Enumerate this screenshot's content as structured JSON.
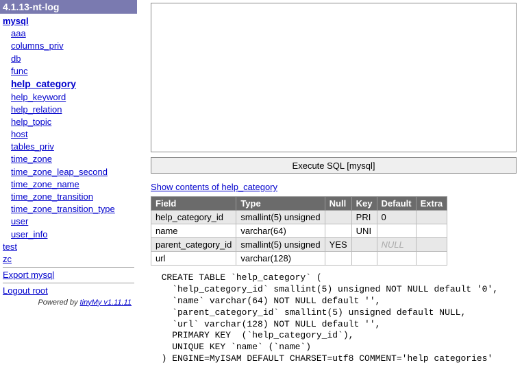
{
  "sidebar": {
    "header": "4.1.13-nt-log",
    "db": "mysql",
    "tables": [
      "aaa",
      "columns_priv",
      "db",
      "func",
      "help_category",
      "help_keyword",
      "help_relation",
      "help_topic",
      "host",
      "tables_priv",
      "time_zone",
      "time_zone_leap_second",
      "time_zone_name",
      "time_zone_transition",
      "time_zone_transition_type",
      "user",
      "user_info"
    ],
    "selected": "help_category",
    "other_dbs": [
      "test",
      "zc"
    ],
    "export": "Export mysql",
    "logout": "Logout root",
    "powered_prefix": "Powered by ",
    "powered_link": "tinyMy v1.11.11"
  },
  "main": {
    "sql_value": "",
    "exec_label": "Execute SQL [mysql]",
    "show_link": "Show contents of help_category",
    "columns": [
      "Field",
      "Type",
      "Null",
      "Key",
      "Default",
      "Extra"
    ],
    "rows": [
      {
        "field": "help_category_id",
        "type": "smallint(5) unsigned",
        "null": "",
        "key": "PRI",
        "default": "0",
        "extra": ""
      },
      {
        "field": "name",
        "type": "varchar(64)",
        "null": "",
        "key": "UNI",
        "default": "",
        "extra": ""
      },
      {
        "field": "parent_category_id",
        "type": "smallint(5) unsigned",
        "null": "YES",
        "key": "",
        "default": "NULL",
        "extra": ""
      },
      {
        "field": "url",
        "type": "varchar(128)",
        "null": "",
        "key": "",
        "default": "",
        "extra": ""
      }
    ],
    "create_sql": "  CREATE TABLE `help_category` (\n    `help_category_id` smallint(5) unsigned NOT NULL default '0',\n    `name` varchar(64) NOT NULL default '',\n    `parent_category_id` smallint(5) unsigned default NULL,\n    `url` varchar(128) NOT NULL default '',\n    PRIMARY KEY  (`help_category_id`),\n    UNIQUE KEY `name` (`name`)\n  ) ENGINE=MyISAM DEFAULT CHARSET=utf8 COMMENT='help categories'"
  }
}
